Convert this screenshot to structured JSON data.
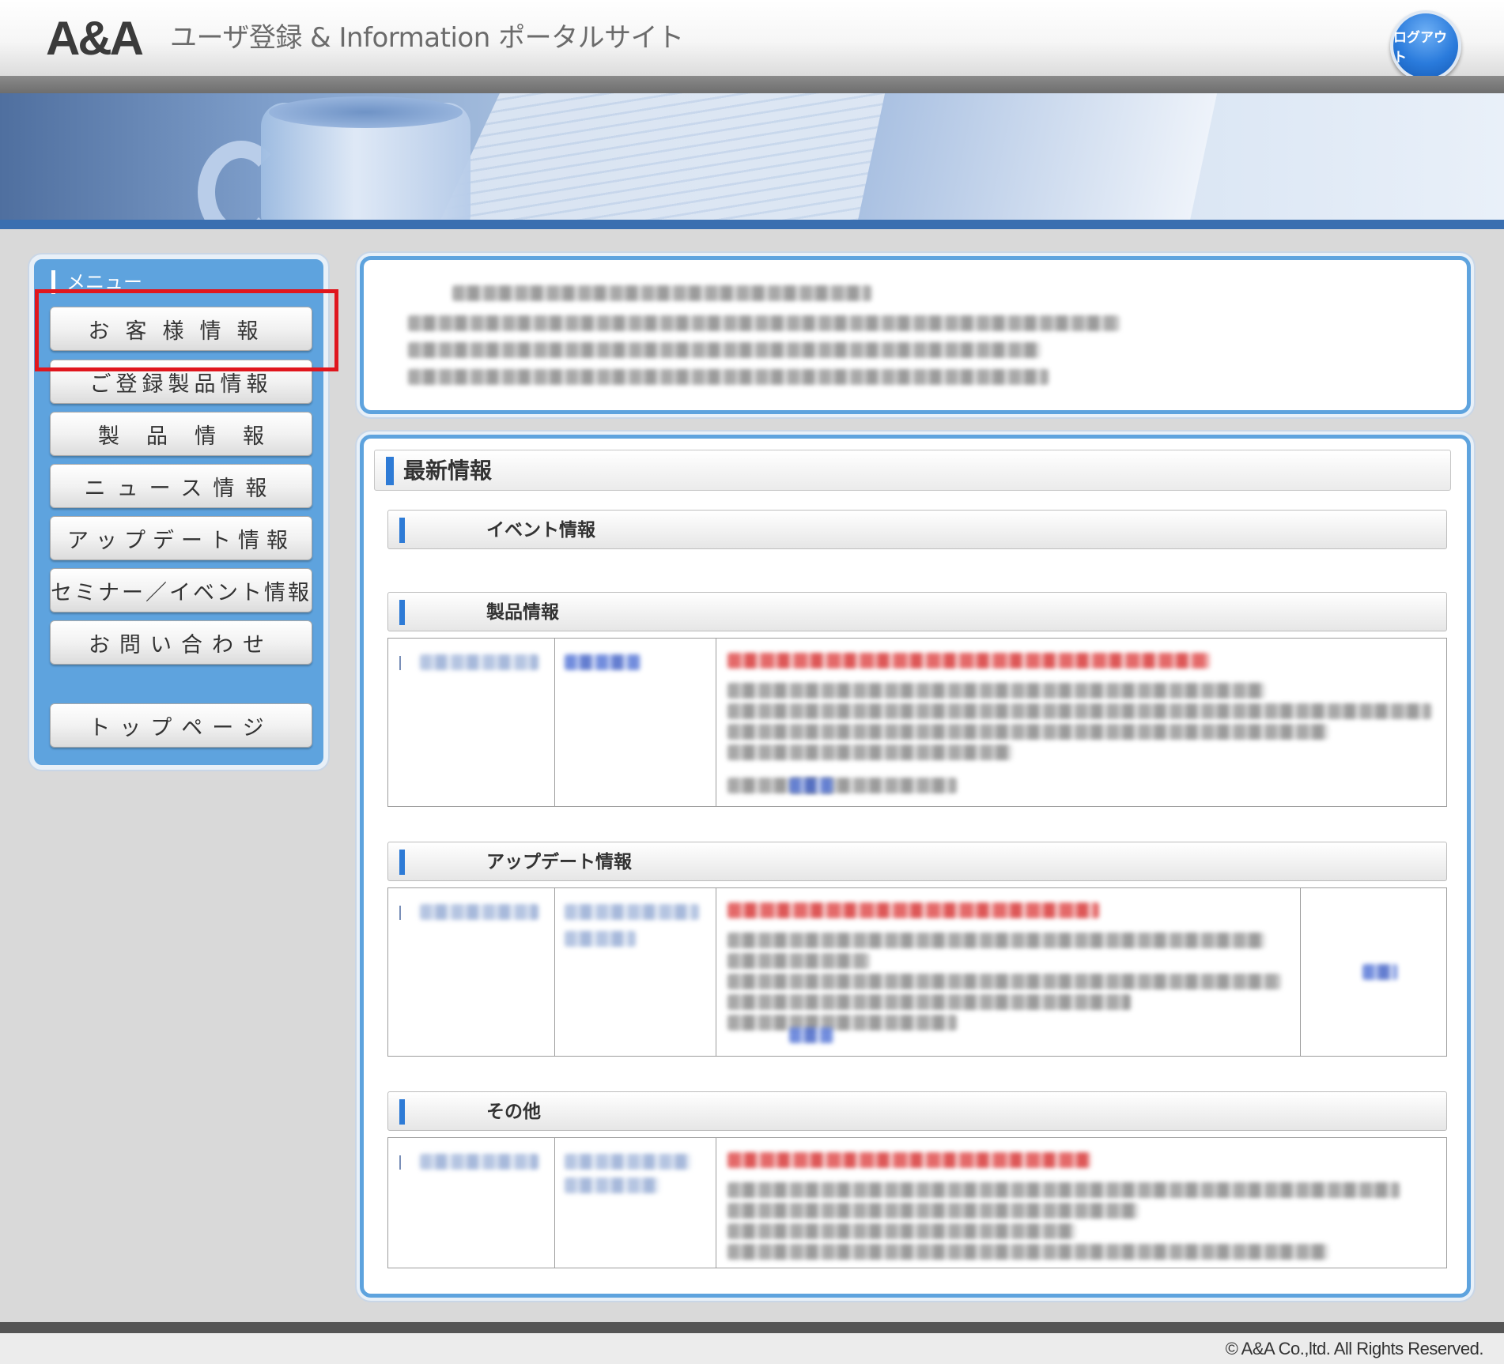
{
  "header": {
    "logo": "A&A",
    "site_title": "ユーザ登録 & Information ポータルサイト",
    "logout_label": "ログアウト"
  },
  "sidebar": {
    "title": "メニュー",
    "items": [
      {
        "label": "お客様情報"
      },
      {
        "label": "ご登録製品情報"
      },
      {
        "label": "製品情報"
      },
      {
        "label": "ニュース情報"
      },
      {
        "label": "アップデート情報"
      },
      {
        "label": "セミナー／イベント情報"
      },
      {
        "label": "お問い合わせ"
      }
    ],
    "top_page_label": "トップページ"
  },
  "news": {
    "title": "最新情報",
    "sections": [
      {
        "title": "イベント情報"
      },
      {
        "title": "製品情報"
      },
      {
        "title": "アップデート情報"
      },
      {
        "title": "その他"
      }
    ]
  },
  "footer": {
    "copyright": "© A&A Co.,ltd. All Rights Reserved."
  },
  "colors": {
    "accent_blue": "#5ea3de",
    "highlight_red": "#e0161d",
    "header_gray": "#6e6e6e"
  }
}
